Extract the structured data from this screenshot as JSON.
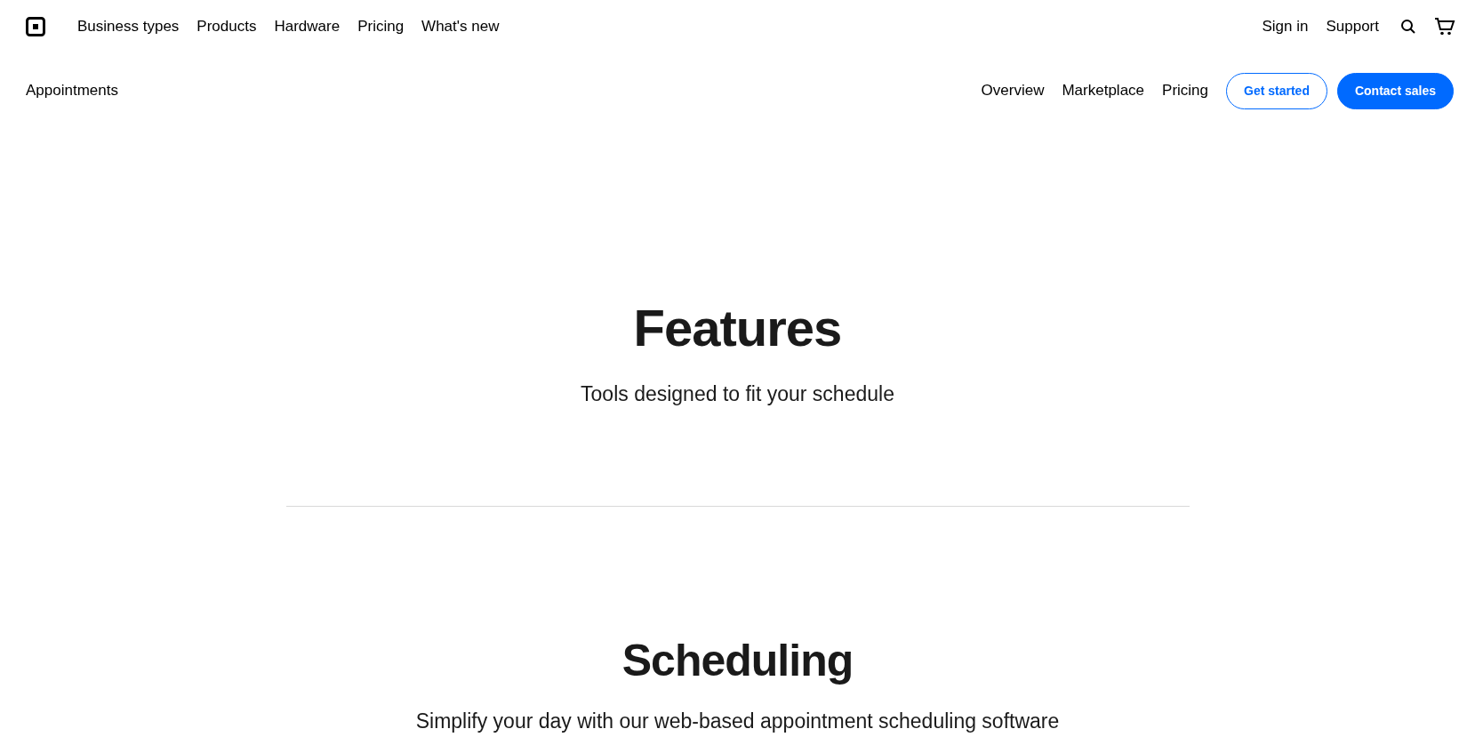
{
  "top_nav": {
    "links": [
      "Business types",
      "Products",
      "Hardware",
      "Pricing",
      "What's new"
    ],
    "utility_links": [
      "Sign in",
      "Support"
    ]
  },
  "sub_nav": {
    "title": "Appointments",
    "links": [
      "Overview",
      "Marketplace",
      "Pricing"
    ],
    "buttons": [
      {
        "label": "Get started",
        "kind": "outline"
      },
      {
        "label": "Contact sales",
        "kind": "filled"
      }
    ]
  },
  "sections": [
    {
      "heading": "Features",
      "subheading": "Tools designed to fit your schedule"
    },
    {
      "heading": "Scheduling",
      "subheading": "Simplify your day with our web-based appointment scheduling software"
    }
  ]
}
